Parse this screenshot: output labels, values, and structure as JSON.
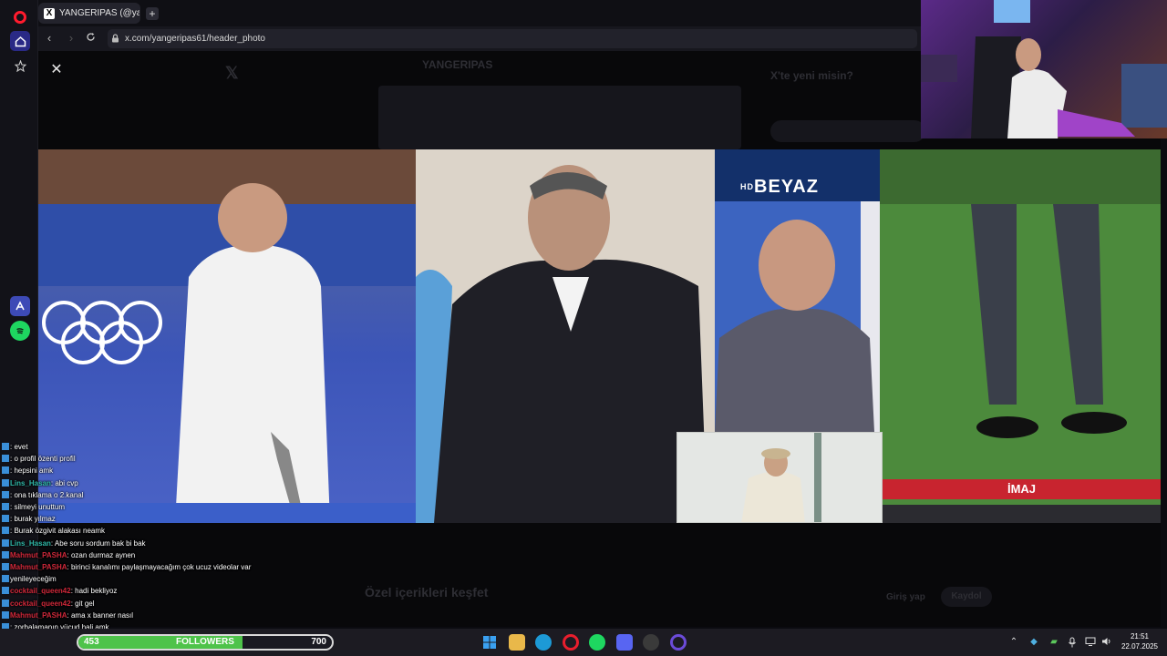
{
  "browser": {
    "tab": {
      "favicon": "X",
      "title": "YANGERİPAS (@yangeripa"
    },
    "new_tab_symbol": "+",
    "url": "x.com/yangeripas61/header_photo"
  },
  "page": {
    "close_symbol": "✕",
    "background_title": "YANGERIPAS",
    "background_side_title": "X'te yeni misin?",
    "background_footer": "Özel içerikleri keşfet",
    "background_buttons": [
      "Giriş yap",
      "Kaydol"
    ]
  },
  "header_photo": {
    "logo_text": "BEYAZ",
    "logo_prefix": "HD",
    "caption": "İMAJ"
  },
  "chat": [
    {
      "user": "",
      "user_class": "u-red",
      "msg": ": evet"
    },
    {
      "user": "",
      "user_class": "u-red",
      "msg": ": o profil özenti profil"
    },
    {
      "user": "",
      "user_class": "u-red",
      "msg": ": hepsini amk"
    },
    {
      "user": "Lins_Hasan",
      "user_class": "u-teal",
      "msg": ": abi cvp"
    },
    {
      "user": "",
      "user_class": "u-red",
      "msg": ": ona tıklama o 2.kanal"
    },
    {
      "user": "",
      "user_class": "u-red",
      "msg": ": silmeyi unuttum"
    },
    {
      "user": "",
      "user_class": "u-red",
      "msg": ": burak yılmaz"
    },
    {
      "user": "",
      "user_class": "u-red",
      "msg": ": Burak özgivit alakası neamk"
    },
    {
      "user": "Lins_Hasan",
      "user_class": "u-teal",
      "msg": ": Abe soru sordum bak bi bak"
    },
    {
      "user": "Mahmut_PASHA",
      "user_class": "u-red",
      "msg": ": ozan durmaz aynen"
    },
    {
      "user": "Mahmut_PASHA",
      "user_class": "u-red",
      "msg": ": birinci kanalımı paylaşmayacağım çok ucuz videolar var"
    },
    {
      "user": "",
      "user_class": "u-red",
      "msg": "yenileyeceğim"
    },
    {
      "user": "cocktail_queen42",
      "user_class": "u-red",
      "msg": ": hadi bekliyoz"
    },
    {
      "user": "cocktail_queen42",
      "user_class": "u-red",
      "msg": ": git gel"
    },
    {
      "user": "Mahmut_PASHA",
      "user_class": "u-red",
      "msg": ": ama x banner nasıl"
    },
    {
      "user": "",
      "user_class": "u-red",
      "msg": ": zorbalamanın vücud hali amk"
    }
  ],
  "followers": {
    "current": "453",
    "label": "FOLLOWERS",
    "goal": "700",
    "progress": 0.647,
    "fill_color": "#4ec34a"
  },
  "taskbar": {
    "apps": [
      {
        "name": "windows-start-icon",
        "glyph": "",
        "color": "#2d8bea"
      },
      {
        "name": "file-explorer-icon",
        "glyph": "",
        "color": "#e9b84a"
      },
      {
        "name": "edge-icon",
        "glyph": "",
        "color": "#1d9ad6"
      },
      {
        "name": "opera-icon",
        "glyph": "",
        "color": "#e81e2d"
      },
      {
        "name": "spotify-icon",
        "glyph": "",
        "color": "#1ed760"
      },
      {
        "name": "discord-icon",
        "glyph": "",
        "color": "#5865f2"
      },
      {
        "name": "obs-icon",
        "glyph": "",
        "color": "#3a3a3a"
      },
      {
        "name": "opera-gx-icon",
        "glyph": "",
        "color": "#6b4bd8"
      }
    ],
    "time": "21:51",
    "date": "22.07.2025"
  }
}
